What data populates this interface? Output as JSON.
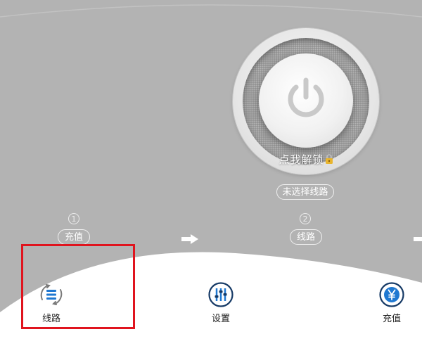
{
  "unlock": {
    "label": "点我解锁",
    "lock_emoji": "🔒"
  },
  "route_status": "未选择线路",
  "steps": [
    {
      "number": "1",
      "label": "充值"
    },
    {
      "number": "2",
      "label": "线路"
    }
  ],
  "tabs": [
    {
      "label": "线路",
      "icon": "list-icon"
    },
    {
      "label": "设置",
      "icon": "sliders-icon"
    },
    {
      "label": "充值",
      "icon": "yen-icon"
    }
  ],
  "colors": {
    "background": "#b3b3b3",
    "tab_icon_blue": "#1f78d1",
    "tab_icon_navy": "#163a66",
    "highlight_red": "#e0141e"
  }
}
